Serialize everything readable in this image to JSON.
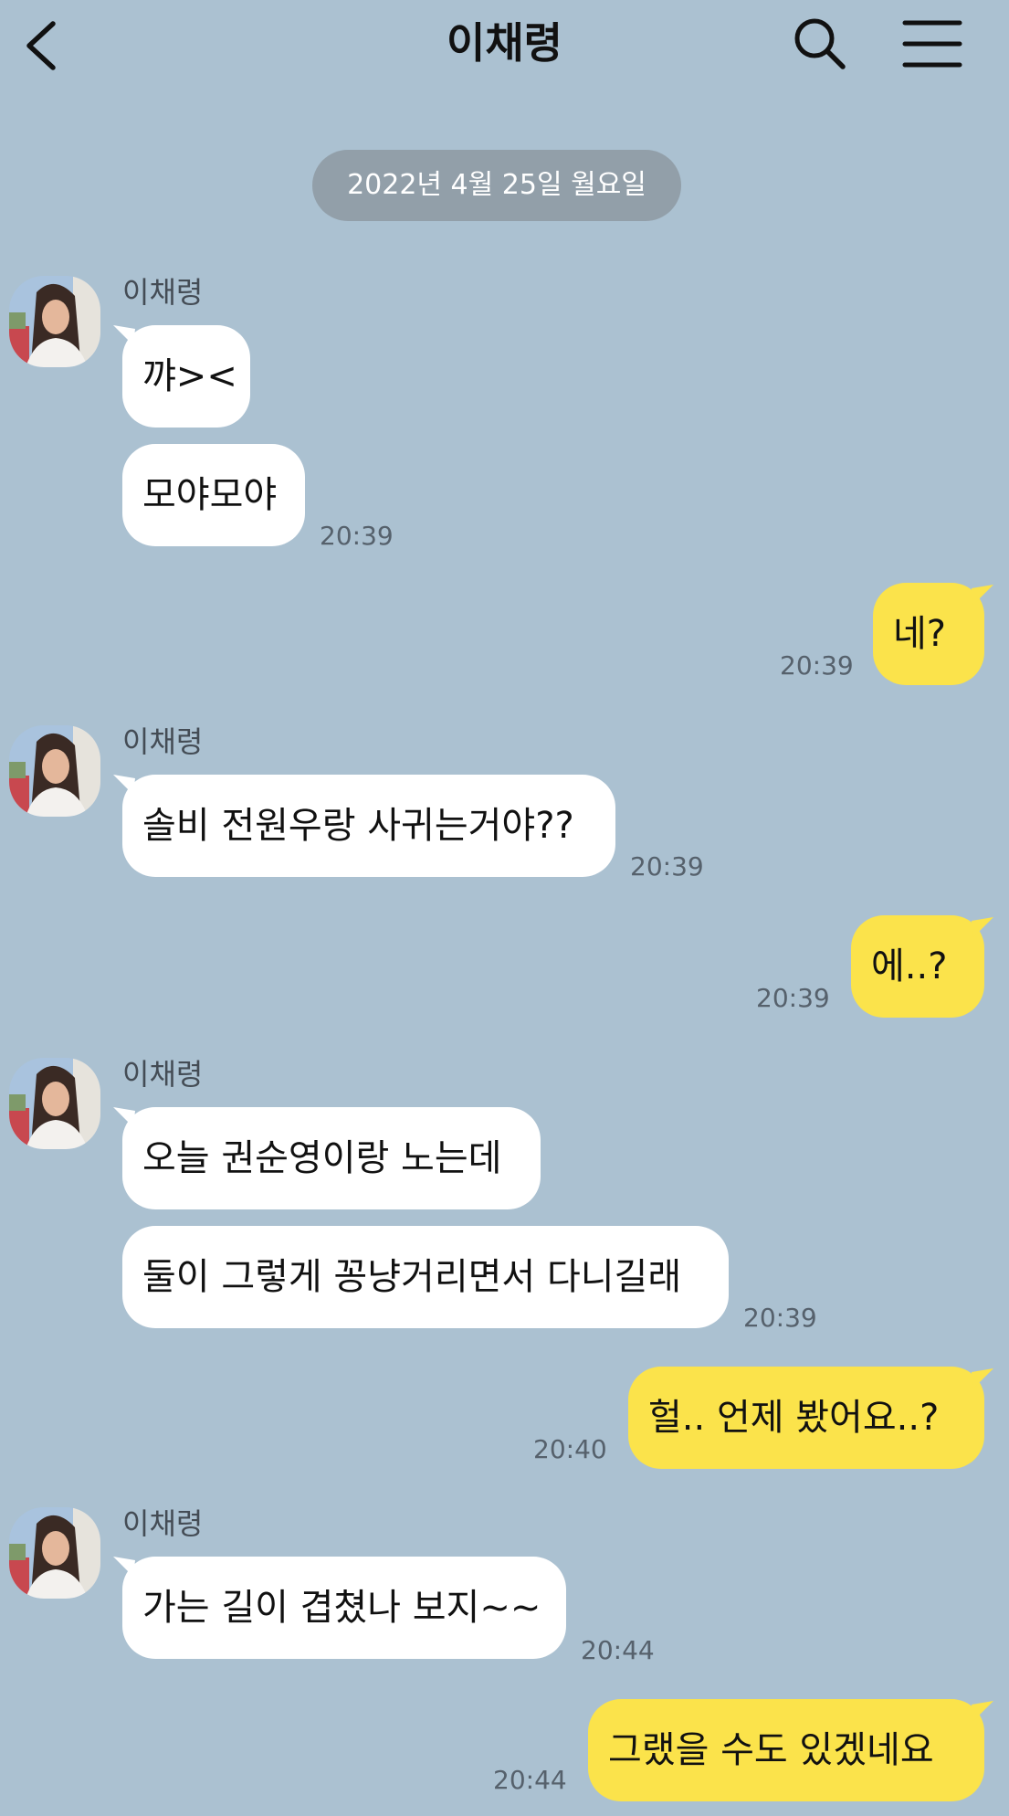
{
  "header": {
    "title": "이채령"
  },
  "date_separator": "2022년 4월 25일 월요일",
  "messages": [
    {
      "sender": "이채령",
      "lines": [
        "꺄><",
        "모야모야"
      ],
      "time": "20:39"
    },
    {
      "from_me": true,
      "text": "네?",
      "time": "20:39"
    },
    {
      "sender": "이채령",
      "lines": [
        "솔비 전원우랑 사귀는거야??"
      ],
      "time": "20:39"
    },
    {
      "from_me": true,
      "text": "에..?",
      "time": "20:39"
    },
    {
      "sender": "이채령",
      "lines": [
        "오늘 권순영이랑 노는데",
        "둘이 그렇게 꽁냥거리면서 다니길래"
      ],
      "time": "20:39"
    },
    {
      "from_me": true,
      "text": "헐.. 언제 봤어요..?",
      "time": "20:40"
    },
    {
      "sender": "이채령",
      "lines": [
        "가는 길이 겹쳤나 보지~~"
      ],
      "time": "20:44"
    },
    {
      "from_me": true,
      "text": "그랬을 수도 있겠네요",
      "time": "20:44"
    }
  ],
  "colors": {
    "background": "#abc1d1",
    "my_bubble": "#fbe34b",
    "their_bubble": "#ffffff",
    "date_pill": "#929fa9"
  },
  "icons": [
    "back-arrow-icon",
    "search-icon",
    "hamburger-menu-icon"
  ]
}
